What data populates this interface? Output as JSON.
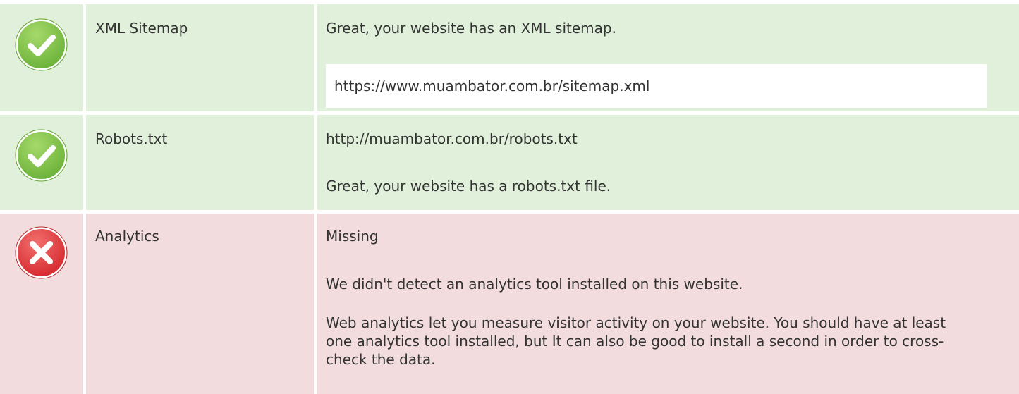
{
  "colors": {
    "ok_row_bg": "#e0f0da",
    "bad_row_bg": "#f2dcde",
    "ok_icon": "#7dc242",
    "bad_icon": "#e0343a",
    "text": "#333333"
  },
  "rows": [
    {
      "status": "ok",
      "icon": "check-circle-icon",
      "name": "XML Sitemap",
      "lines": [
        "Great, your website has an XML sitemap."
      ],
      "url": "https://www.muambator.com.br/sitemap.xml"
    },
    {
      "status": "ok",
      "icon": "check-circle-icon",
      "name": "Robots.txt",
      "lines": [
        "http://muambator.com.br/robots.txt",
        "Great, your website has a robots.txt file."
      ]
    },
    {
      "status": "bad",
      "icon": "x-circle-icon",
      "name": "Analytics",
      "lines": [
        "Missing",
        "We didn't detect an analytics tool installed on this website.",
        "Web analytics let you measure visitor activity on your website. You should have at least one analytics tool installed, but It can also be good to install a second in order to cross-check the data."
      ]
    }
  ]
}
